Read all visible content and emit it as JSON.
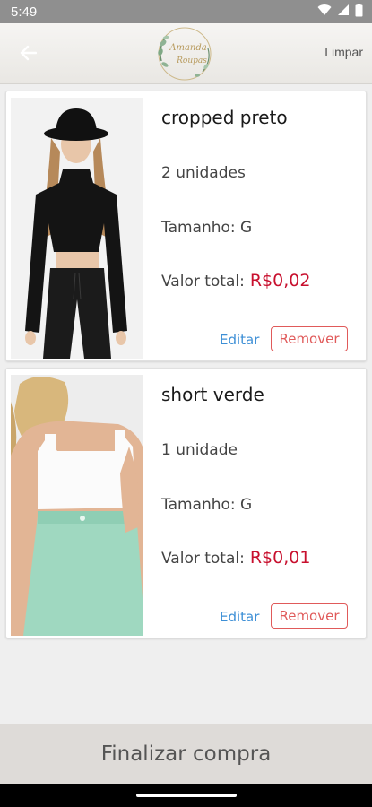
{
  "status_bar": {
    "time": "5:49"
  },
  "header": {
    "clear_label": "Limpar",
    "logo_text_line1": "Amanda",
    "logo_text_line2": "Roupas"
  },
  "cart": {
    "items": [
      {
        "name": "cropped preto",
        "quantity": "2 unidades",
        "size": "Tamanho: G",
        "total_label": "Valor total:",
        "total_value": "R$0,02",
        "edit_label": "Editar",
        "remove_label": "Remover"
      },
      {
        "name": "short verde",
        "quantity": "1 unidade",
        "size": "Tamanho: G",
        "total_label": "Valor total:",
        "total_value": "R$0,01",
        "edit_label": "Editar",
        "remove_label": "Remover"
      }
    ]
  },
  "footer": {
    "checkout_label": "Finalizar compra"
  },
  "colors": {
    "price": "#c8102e",
    "edit": "#3d8fd6",
    "remove": "#e05a5a",
    "checkout_bg": "#dedbd8"
  }
}
